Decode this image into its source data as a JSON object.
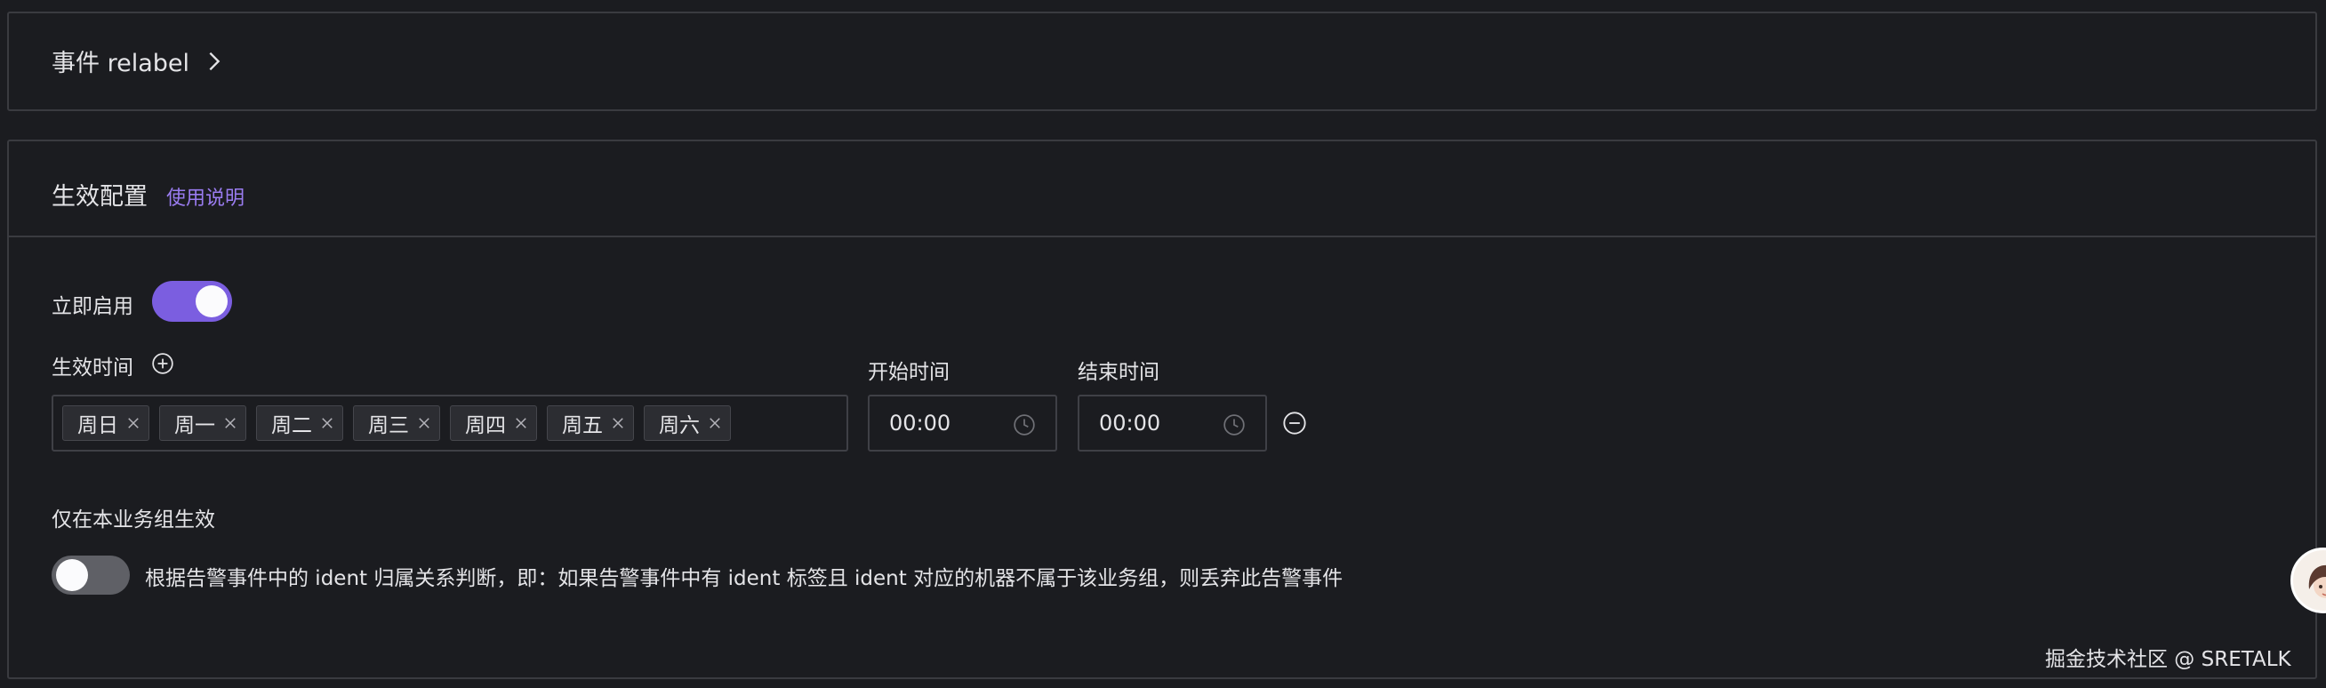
{
  "relabel": {
    "title": "事件 relabel"
  },
  "effect": {
    "title": "生效配置",
    "help_link": "使用说明",
    "enable_now_label": "立即启用",
    "enable_now_on": true,
    "effective_time_label": "生效时间",
    "weekdays": [
      "周日",
      "周一",
      "周二",
      "周三",
      "周四",
      "周五",
      "周六"
    ],
    "start_time_label": "开始时间",
    "start_time_value": "00:00",
    "end_time_label": "结束时间",
    "end_time_value": "00:00",
    "busi_group_only_label": "仅在本业务组生效",
    "busi_group_only_on": false,
    "busi_group_only_desc": "根据告警事件中的 ident 归属关系判断，即：如果告警事件中有 ident 标签且 ident 对应的机器不属于该业务组，则丢弃此告警事件"
  },
  "watermark": "掘金技术社区 @ SRETALK",
  "colors": {
    "accent": "#7b5ee0",
    "link": "#9a7cf0",
    "background": "#1b1c20",
    "border": "#3a3b40"
  },
  "icons": [
    "chevron-right-icon",
    "plus-circle-icon",
    "close-icon",
    "clock-icon",
    "minus-circle-icon"
  ]
}
